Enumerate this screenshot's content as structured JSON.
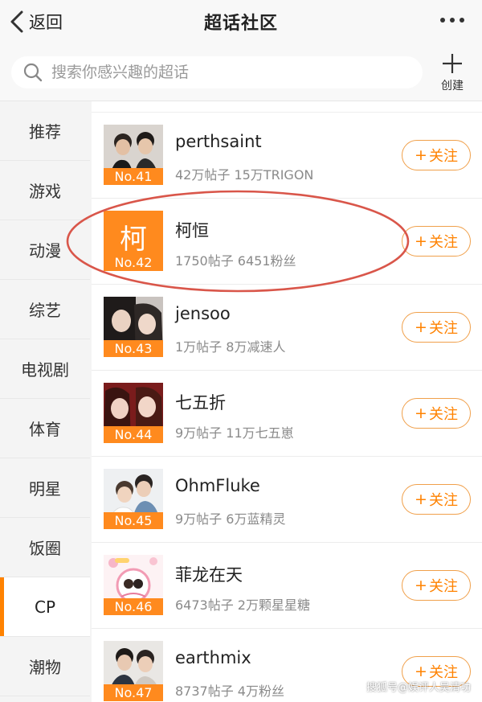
{
  "header": {
    "back_label": "返回",
    "title": "超话社区"
  },
  "search": {
    "placeholder": "搜索你感兴趣的超话",
    "create_label": "创建"
  },
  "sidebar": {
    "items": [
      {
        "label": "推荐"
      },
      {
        "label": "游戏"
      },
      {
        "label": "动漫"
      },
      {
        "label": "综艺"
      },
      {
        "label": "电视剧"
      },
      {
        "label": "体育"
      },
      {
        "label": "明星"
      },
      {
        "label": "饭圈"
      },
      {
        "label": "CP"
      },
      {
        "label": "潮物"
      }
    ],
    "active": "CP"
  },
  "list": {
    "follow_plus": "+",
    "follow_label": "关注",
    "items": [
      {
        "rank": "No.41",
        "name": "perthsaint",
        "stats": "42万帖子 15万TRIGON",
        "thumb": "photo-two-men"
      },
      {
        "rank": "No.42",
        "name": "柯恒",
        "stats": "1750帖子 6451粉丝",
        "thumb_char": "柯",
        "thumb": "orange-letter-tile"
      },
      {
        "rank": "No.43",
        "name": "jensoo",
        "stats": "1万帖子 8万减速人",
        "thumb": "photo-two-women"
      },
      {
        "rank": "No.44",
        "name": "七五折",
        "stats": "9万帖子 11万七五崽",
        "thumb": "photo-two-women-red"
      },
      {
        "rank": "No.45",
        "name": "OhmFluke",
        "stats": "9万帖子 6万蓝精灵",
        "thumb": "photo-two-men-light"
      },
      {
        "rank": "No.46",
        "name": "菲龙在天",
        "stats": "6473帖子 2万颗星星糖",
        "thumb": "pink-illustration"
      },
      {
        "rank": "No.47",
        "name": "earthmix",
        "stats": "8737帖子 4万粉丝",
        "thumb": "photo-two-men-suits"
      }
    ]
  },
  "watermark": "搜狐号@娱评人吴清功",
  "colors": {
    "accent": "#ff8200",
    "rank_bg": "#ff8a1e",
    "highlight_circle": "#d9564a"
  }
}
